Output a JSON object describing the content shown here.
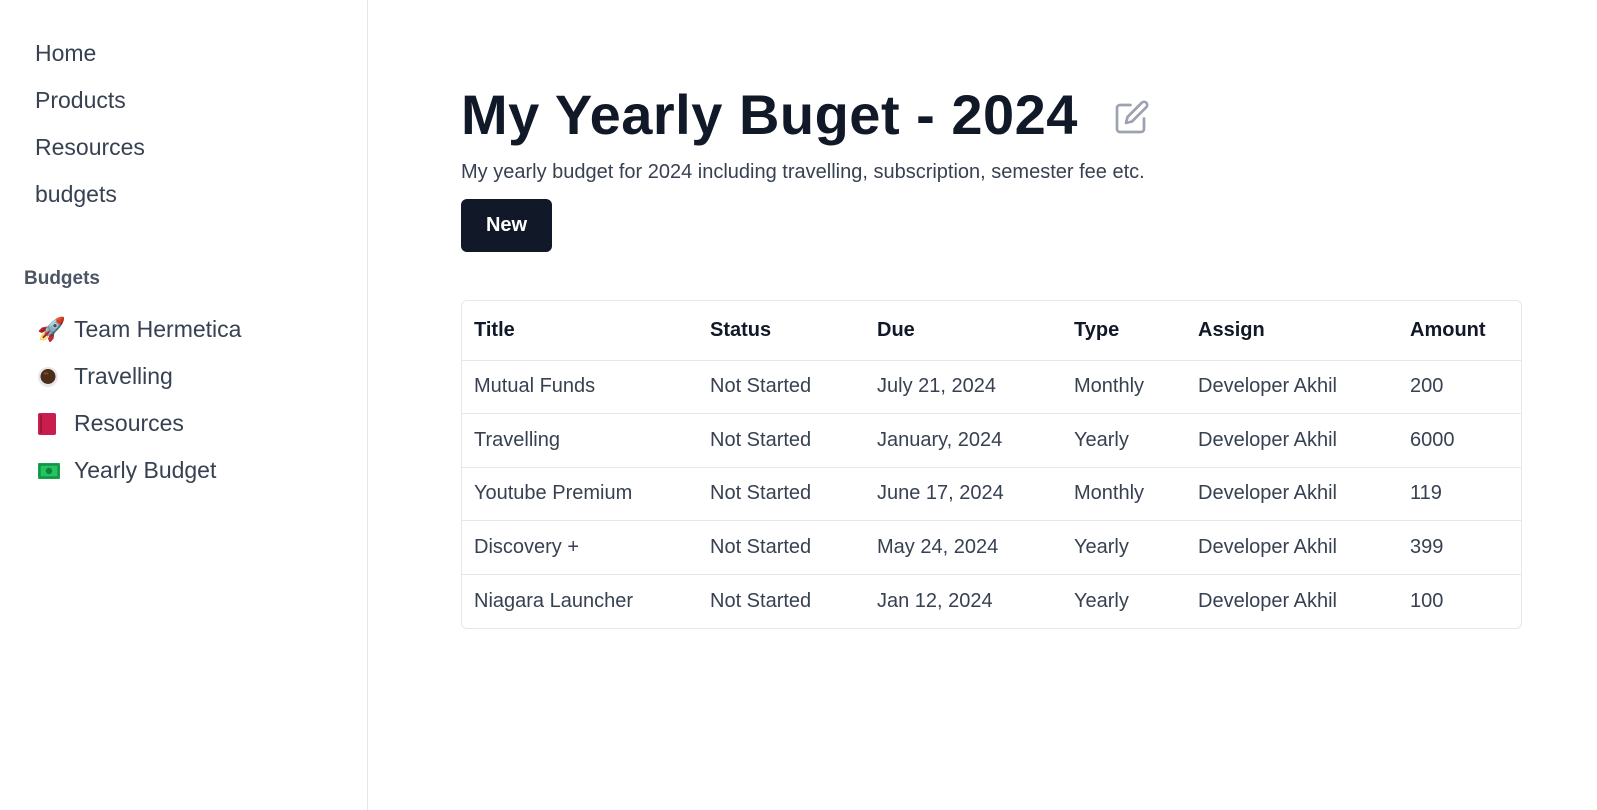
{
  "nav": {
    "items": [
      {
        "label": "Home"
      },
      {
        "label": "Products"
      },
      {
        "label": "Resources"
      },
      {
        "label": "budgets"
      }
    ]
  },
  "budgets_section": {
    "label": "Budgets",
    "items": [
      {
        "emoji": "🚀",
        "icon": "rocket-icon",
        "label": "Team Hermetica"
      },
      {
        "emoji": "☕",
        "icon": "coffee-icon",
        "label": "Travelling"
      },
      {
        "emoji": "📕",
        "icon": "book-icon",
        "label": "Resources"
      },
      {
        "emoji": "💵",
        "icon": "money-icon",
        "label": "Yearly Budget"
      }
    ]
  },
  "header": {
    "title": "My Yearly Buget - 2024",
    "subtitle": "My yearly budget for 2024 including travelling, subscription, semester fee etc.",
    "new_label": "New"
  },
  "table": {
    "columns": [
      "Title",
      "Status",
      "Due",
      "Type",
      "Assign",
      "Amount"
    ],
    "rows": [
      [
        "Mutual Funds",
        "Not Started",
        "July 21, 2024",
        "Monthly",
        "Developer Akhil",
        "200"
      ],
      [
        "Travelling",
        "Not Started",
        "January, 2024",
        "Yearly",
        "Developer Akhil",
        "6000"
      ],
      [
        "Youtube Premium",
        "Not Started",
        "June 17, 2024",
        "Monthly",
        "Developer Akhil",
        "119"
      ],
      [
        "Discovery +",
        "Not Started",
        "May 24, 2024",
        "Yearly",
        "Developer Akhil",
        "399"
      ],
      [
        "Niagara Launcher",
        "Not Started",
        "Jan 12, 2024",
        "Yearly",
        "Developer Akhil",
        "100"
      ]
    ]
  },
  "colors": {
    "primary": "#111827",
    "text": "#374151",
    "border": "#e5e7eb",
    "muted": "#9ca3af"
  }
}
